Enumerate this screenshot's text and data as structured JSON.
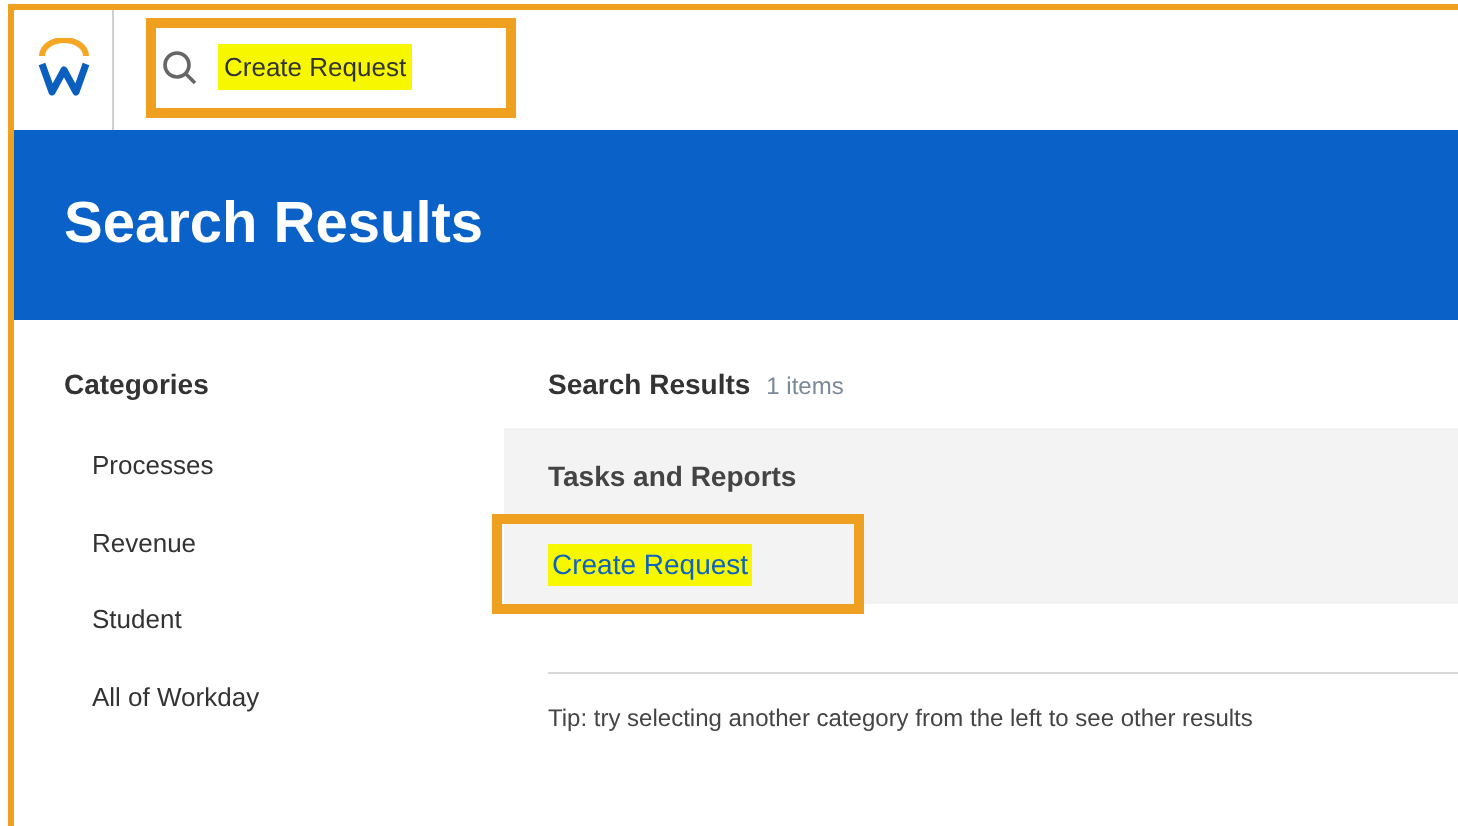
{
  "header": {
    "search": {
      "value": "Create Request",
      "highlighted": true
    }
  },
  "banner": {
    "title": "Search Results"
  },
  "categories": {
    "heading": "Categories",
    "items": [
      {
        "label": "Processes"
      },
      {
        "label": "Revenue"
      },
      {
        "label": "Student"
      },
      {
        "label": "All of Workday"
      }
    ]
  },
  "results": {
    "heading": "Search Results",
    "count": "1 items",
    "group": {
      "heading": "Tasks and Reports",
      "items": [
        {
          "label": "Create Request",
          "highlighted": true
        }
      ]
    },
    "tip": "Tip: try selecting another category from the left to see other results"
  }
}
